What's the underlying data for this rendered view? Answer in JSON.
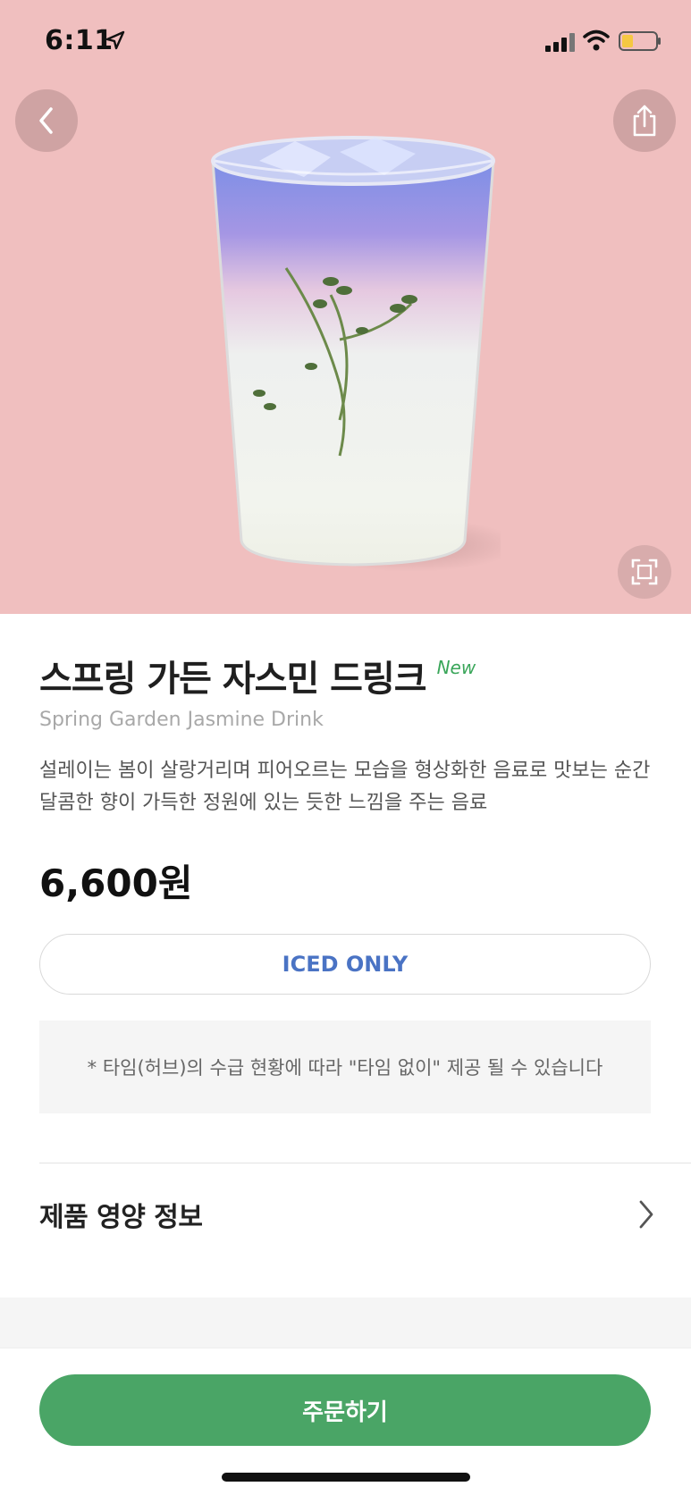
{
  "status_bar": {
    "time": "6:11",
    "icons": [
      "location-arrow-icon",
      "cellular-signal-icon",
      "wifi-icon",
      "battery-icon"
    ]
  },
  "header": {
    "back_icon": "chevron-left-icon",
    "share_icon": "share-icon",
    "zoom_icon": "fullscreen-icon"
  },
  "product": {
    "name_ko": "스프링 가든 자스민 드링크",
    "new_badge": "New",
    "name_en": "Spring Garden Jasmine Drink",
    "description": "설레이는 봄이 살랑거리며 피어오르는 모습을 형상화한 음료로 맛보는 순간 달콤한 향이 가득한 정원에 있는 듯한 느낌을 주는 음료",
    "price": "6,600원",
    "temperature_option": "ICED ONLY",
    "notice": "* 타임(허브)의 수급 현황에 따라 \"타임 없이\" 제공 될 수 있습니다"
  },
  "nutrition": {
    "label": "제품 영양 정보",
    "icon": "chevron-right-icon"
  },
  "footer": {
    "order_label": "주문하기"
  },
  "colors": {
    "hero_background": "#f0bfbf",
    "accent_green": "#4aa566",
    "new_badge_green": "#3aa65a",
    "iced_blue": "#4a73c4",
    "battery_fill": "#f5c842"
  }
}
